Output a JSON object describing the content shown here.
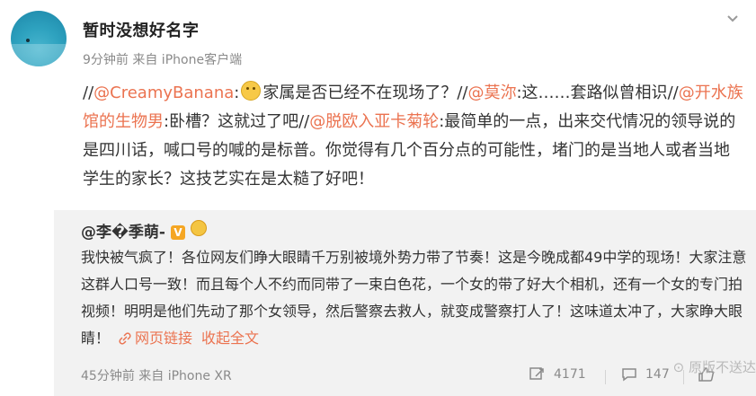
{
  "header": {
    "username": "暂时没想好名字",
    "meta": "9分钟前 来自 iPhone客户端"
  },
  "post": {
    "part1": "//",
    "mention1": "@CreamyBanana",
    "part2": ":",
    "emoji1": "thinking-emoji",
    "part3": "家属是否已经不在现场了？",
    "sep2": "//",
    "mention2": "@莫沵",
    "part4": ":这……套路似曾相识",
    "sep3": "//",
    "mention3": "@开水族馆的生物男",
    "part5": ":卧槽？这就过了吧",
    "sep4": "//",
    "mention4": "@脱欧入亚卡菊轮",
    "part6": ":最简单的一点，出来交代情况的领导说的是四川话，喊口号的喊的是标普。你觉得有几个百分点的可能性，堵门的是当地人或者当地学生的家长？这技艺实在是太糙了好吧！"
  },
  "quote": {
    "username": "@李�季萌-",
    "badge": "V",
    "text": "我快被气疯了！各位网友们睁大眼睛千万别被境外势力带了节奏！这是今晚成都49中学的现场！大家注意这群人口号一致！而且每个人不约而同带了一束白色花，一个女的带了好大个相机，还有一个女的专门拍视频！明明是他们先动了那个女领导，然后警察去救人，就变成警察打人了！这味道太冲了，大家睁大眼睛！",
    "weblink": "网页链接",
    "collapse": "收起全文",
    "meta": "45分钟前 来自 iPhone XR",
    "repost_count": "4171",
    "comment_count": "147",
    "like_count": ""
  },
  "watermark": "⊙ 原版不送达"
}
